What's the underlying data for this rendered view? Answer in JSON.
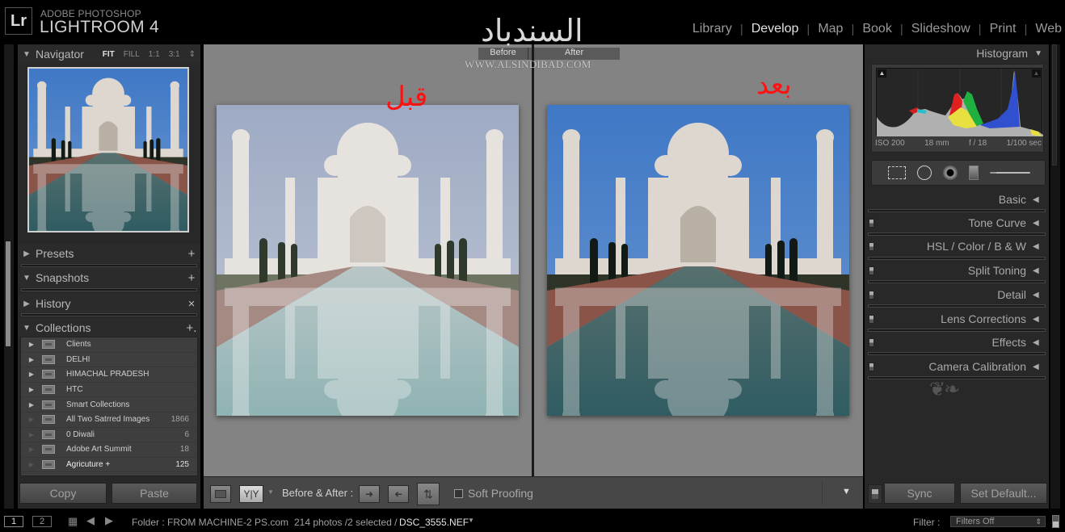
{
  "app": {
    "logo": "Lr",
    "subtitle": "ADOBE PHOTOSHOP",
    "name": "LIGHTROOM 4"
  },
  "modules": [
    {
      "label": "Library",
      "active": false
    },
    {
      "label": "Develop",
      "active": true
    },
    {
      "label": "Map",
      "active": false
    },
    {
      "label": "Book",
      "active": false
    },
    {
      "label": "Slideshow",
      "active": false
    },
    {
      "label": "Print",
      "active": false
    },
    {
      "label": "Web",
      "active": false
    }
  ],
  "watermark": {
    "text": "السندباد",
    "url": "WWW.ALSINDIBAD.COM"
  },
  "left_panel": {
    "navigator": {
      "title": "Navigator",
      "zoom_options": [
        "FIT",
        "FILL",
        "1:1",
        "3:1"
      ],
      "active_zoom": "FIT"
    },
    "presets": {
      "title": "Presets",
      "action": "+"
    },
    "snapshots": {
      "title": "Snapshots",
      "action": "+"
    },
    "history": {
      "title": "History",
      "action": "×"
    },
    "collections": {
      "title": "Collections",
      "action": "+.",
      "items": [
        {
          "name": "Clients",
          "count": "",
          "type": "set"
        },
        {
          "name": "DELHI",
          "count": "",
          "type": "set"
        },
        {
          "name": "HIMACHAL PRADESH",
          "count": "",
          "type": "set"
        },
        {
          "name": "HTC",
          "count": "",
          "type": "set"
        },
        {
          "name": "Smart Collections",
          "count": "",
          "type": "set"
        },
        {
          "name": "All Two Satrred Images",
          "count": "1866",
          "type": "smart"
        },
        {
          "name": "0 Diwali",
          "count": "6",
          "type": "collection"
        },
        {
          "name": "Adobe Art Summit",
          "count": "18",
          "type": "collection"
        },
        {
          "name": "Agricuture  +",
          "count": "125",
          "type": "collection"
        }
      ]
    },
    "copy_label": "Copy",
    "paste_label": "Paste"
  },
  "center": {
    "before_label": "Before",
    "after_label": "After",
    "before_overlay": "قبل",
    "after_overlay": "بعد",
    "overlay_color": "#ff1111"
  },
  "toolbar": {
    "ba_label": "Before & After :",
    "yy_label": "Y|Y",
    "soft_proofing": "Soft Proofing",
    "soft_proofing_checked": false
  },
  "right_panel": {
    "histogram": {
      "title": "Histogram",
      "iso": "ISO 200",
      "focal": "18 mm",
      "aperture": "f / 18",
      "shutter": "1/100 sec"
    },
    "sections": [
      "Basic",
      "Tone Curve",
      "HSL  /  Color  /  B & W",
      "Split Toning",
      "Detail",
      "Lens Corrections",
      "Effects",
      "Camera Calibration"
    ],
    "sync_label": "Sync",
    "set_default_label": "Set Default..."
  },
  "statusbar": {
    "page1": "1",
    "page2": "2",
    "folder": "Folder : FROM MACHINE-2 PS.com",
    "selection": "214 photos /2 selected /",
    "filename": "DSC_3555.NEF",
    "filter_label": "Filter :",
    "filter_value": "Filters Off"
  }
}
